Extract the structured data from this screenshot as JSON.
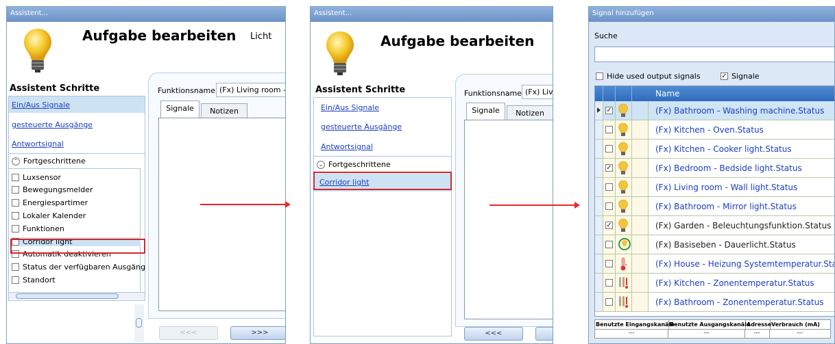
{
  "win1": {
    "title": "Assistent...",
    "heading": "Aufgabe bearbeiten",
    "subtitle": "Licht",
    "steps_title": "Assistent Schritte",
    "steps": [
      "Ein/Aus Signale",
      "gesteuerte Ausgänge",
      "Antwortsignal"
    ],
    "advanced_label": "Fortgeschrittene",
    "options": [
      "Luxsensor",
      "Bewegungsmelder",
      "Energiespartimer",
      "Lokaler Kalender",
      "Funktionen",
      "Corridor light",
      "Automatik deaktivieren",
      "Status der verfügbaren Ausgäng",
      "Standort"
    ],
    "fn_label": "Funktionsname",
    "fn_value": "(Fx) Living room -",
    "tabs": [
      "Signale",
      "Notizen"
    ],
    "btn_prev": "<<<",
    "btn_next": ">>>"
  },
  "win2": {
    "title": "Assistent...",
    "heading": "Aufgabe bearbeiten",
    "steps_title": "Assistent Schritte",
    "steps": [
      "Ein/Aus Signale",
      "gesteuerte Ausgänge",
      "Antwortsignal"
    ],
    "advanced_label": "Fortgeschrittene",
    "added_step": "Corridor light",
    "fn_label": "Funktionsname",
    "fn_value": "(Fx) Liv",
    "tabs": [
      "Signale",
      "Notizen"
    ],
    "btn_prev": "<<<"
  },
  "win3": {
    "title": "Signal hinzufügen",
    "search_label": "Suche",
    "search_value": "",
    "hide_label": "Hide used output signals",
    "signale_label": "Signale",
    "col_name": "Name",
    "rows": [
      {
        "checked": true,
        "icon": "bulb-icon",
        "name": "(Fx) Bathroom - Washing machine.Status",
        "link": true
      },
      {
        "checked": false,
        "icon": "bulb-icon",
        "name": "(Fx) Kitchen - Oven.Status",
        "link": true
      },
      {
        "checked": false,
        "icon": "bulb-icon",
        "name": "(Fx) Kitchen - Cooker light.Status",
        "link": true
      },
      {
        "checked": true,
        "icon": "bulb-icon",
        "name": "(Fx) Bedroom - Bedside light.Status",
        "link": true
      },
      {
        "checked": false,
        "icon": "bulb-icon",
        "name": "(Fx) Living room - Wall light.Status",
        "link": true
      },
      {
        "checked": false,
        "icon": "bulb-icon",
        "name": "(Fx) Bathroom - Mirror light.Status",
        "link": true
      },
      {
        "checked": true,
        "icon": "bulb-icon",
        "name": "(Fx) Garden - Beleuchtungsfunktion.Status",
        "link": false
      },
      {
        "checked": false,
        "icon": "permanent-light-icon",
        "name": "(Fx) Basiseben - Dauerlicht.Status",
        "link": false
      },
      {
        "checked": false,
        "icon": "thermometer-icon",
        "name": "(Fx) House - Heizung Systemtemperatur.Sta",
        "link": true
      },
      {
        "checked": false,
        "icon": "zone-temp-icon",
        "name": "(Fx) Kitchen - Zonentemperatur.Status",
        "link": true
      },
      {
        "checked": false,
        "icon": "zone-temp-icon",
        "name": "(Fx) Bathroom - Zonentemperatur.Status",
        "link": true
      }
    ],
    "footer_headers": [
      "Benutzte Eingangskanäle",
      "Benutzte Ausgangskanäle",
      "Adresse",
      "Verbrauch (mA)"
    ],
    "footer_values": [
      "---",
      "---",
      "---",
      "---"
    ]
  }
}
